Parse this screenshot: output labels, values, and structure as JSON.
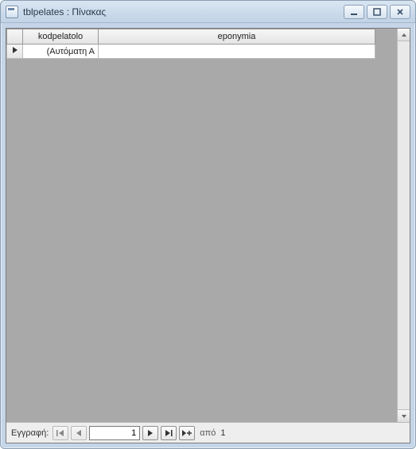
{
  "window": {
    "title": "tblpelates : Πίνακας"
  },
  "table": {
    "columns": {
      "kod": "kodpelatolo",
      "epo": "eponymia"
    },
    "rows": [
      {
        "kod": "(Αυτόματη Α",
        "epo": ""
      }
    ]
  },
  "nav": {
    "label": "Εγγραφή:",
    "current": "1",
    "of_label": "από",
    "total": "1"
  }
}
